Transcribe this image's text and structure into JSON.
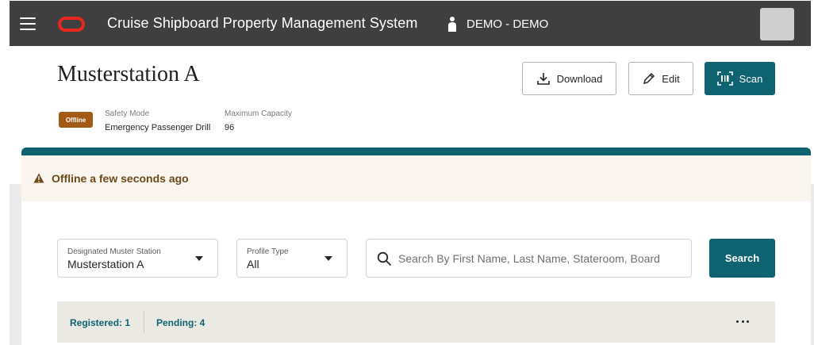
{
  "header": {
    "app_title": "Cruise Shipboard Property Management System",
    "user_label": "DEMO - DEMO",
    "brand_color": "#e8281e",
    "bar_color": "#3f3f3f"
  },
  "page": {
    "title": "Musterstation A",
    "status_badge": "Offline",
    "status_color": "#a25a16",
    "safety_mode_label": "Safety Mode",
    "safety_mode_value": "Emergency Passenger Drill",
    "max_capacity_label": "Maximum Capacity",
    "max_capacity_value": "96"
  },
  "toolbar": {
    "download_label": "Download",
    "edit_label": "Edit",
    "scan_label": "Scan",
    "accent_color": "#0f6371"
  },
  "banner": {
    "text": "Offline a few seconds ago",
    "icon": "warning-icon"
  },
  "filters": {
    "station_label": "Designated Muster Station",
    "station_value": "Musterstation A",
    "profile_label": "Profile Type",
    "profile_value": "All",
    "search_placeholder": "Search By First Name, Last Name, Stateroom, Board",
    "search_button": "Search"
  },
  "summary": {
    "registered": "Registered: 1",
    "pending": "Pending: 4",
    "more_icon": "more-horizontal-icon"
  }
}
